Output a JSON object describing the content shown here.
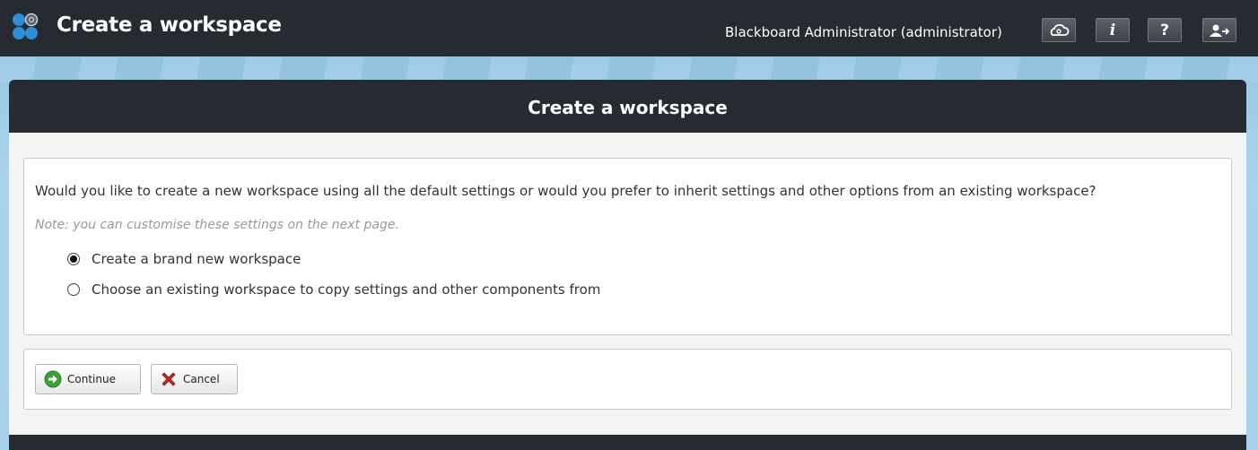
{
  "header": {
    "title": "Create a workspace",
    "user": "Blackboard Administrator (administrator)",
    "buttons": [
      {
        "icon": "cloud-icon"
      },
      {
        "icon": "info-icon",
        "label": "i"
      },
      {
        "icon": "help-icon",
        "label": "?"
      },
      {
        "icon": "logout-icon"
      }
    ]
  },
  "panel": {
    "title": "Create a workspace",
    "question": "Would you like to create a new workspace using all the default settings or would you prefer to inherit settings and other options from an existing workspace?",
    "note": "Note: you can customise these settings on the next page.",
    "options": [
      {
        "label": "Create a brand new workspace",
        "selected": true
      },
      {
        "label": "Choose an existing workspace to copy settings and other components from",
        "selected": false
      }
    ]
  },
  "actions": {
    "continue_label": "Continue",
    "cancel_label": "Cancel"
  },
  "colors": {
    "header_bg": "#262b31",
    "background": "#a7d1ea",
    "continue_icon": "#3aa335",
    "cancel_icon": "#c0262d"
  }
}
